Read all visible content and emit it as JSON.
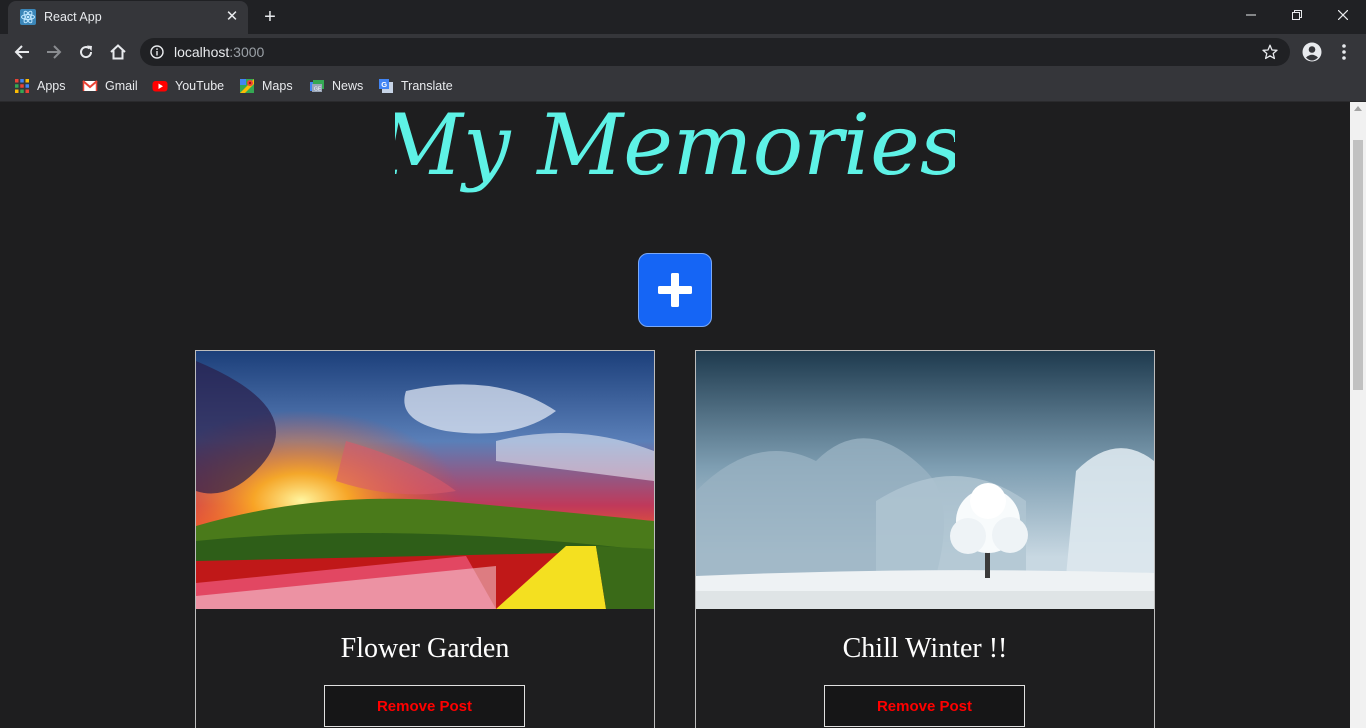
{
  "browser": {
    "tab_title": "React App",
    "url_host": "localhost",
    "url_port": ":3000",
    "bookmarks": [
      {
        "label": "Apps",
        "icon": "apps-grid-icon"
      },
      {
        "label": "Gmail",
        "icon": "gmail-icon"
      },
      {
        "label": "YouTube",
        "icon": "youtube-icon"
      },
      {
        "label": "Maps",
        "icon": "maps-icon"
      },
      {
        "label": "News",
        "icon": "news-icon"
      },
      {
        "label": "Translate",
        "icon": "translate-icon"
      }
    ]
  },
  "page": {
    "title": "My Memories",
    "title_color": "#5ef2e6",
    "add_button_color": "#1565f5"
  },
  "posts": [
    {
      "title": "Flower Garden",
      "remove_label": "Remove Post",
      "image": "flower-field-sunset"
    },
    {
      "title": "Chill Winter !!",
      "remove_label": "Remove Post",
      "image": "snowy-tree-landscape"
    }
  ]
}
